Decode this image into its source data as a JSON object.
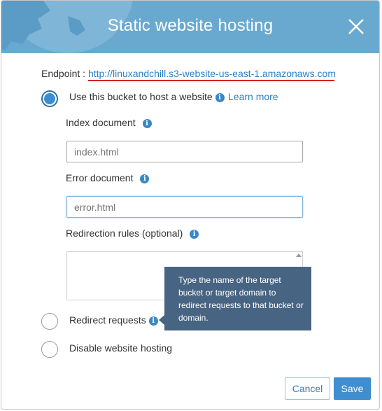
{
  "header": {
    "title": "Static website hosting",
    "close_icon": "close-icon"
  },
  "endpoint": {
    "label": "Endpoint :",
    "url": "http://linuxandchill.s3-website-us-east-1.amazonaws.com"
  },
  "options": {
    "host": {
      "label": "Use this bucket to host a website",
      "learn_more": "Learn more",
      "selected": true
    },
    "redirect": {
      "label": "Redirect requests",
      "selected": false
    },
    "disable": {
      "label": "Disable website hosting",
      "selected": false
    }
  },
  "fields": {
    "index": {
      "label": "Index document",
      "placeholder": "index.html"
    },
    "error": {
      "label": "Error document",
      "placeholder": "error.html"
    },
    "redirection": {
      "label": "Redirection rules (optional)",
      "value": ""
    }
  },
  "tooltip": {
    "text": "Type the name of the target bucket or target domain to redirect requests to that bucket or domain."
  },
  "footer": {
    "cancel_label": "Cancel",
    "save_label": "Save"
  },
  "colors": {
    "header": "#6aa9cf",
    "accent": "#3f8fd0",
    "tooltip": "#476482",
    "link": "#2f7fbf",
    "underline": "#d42020"
  }
}
